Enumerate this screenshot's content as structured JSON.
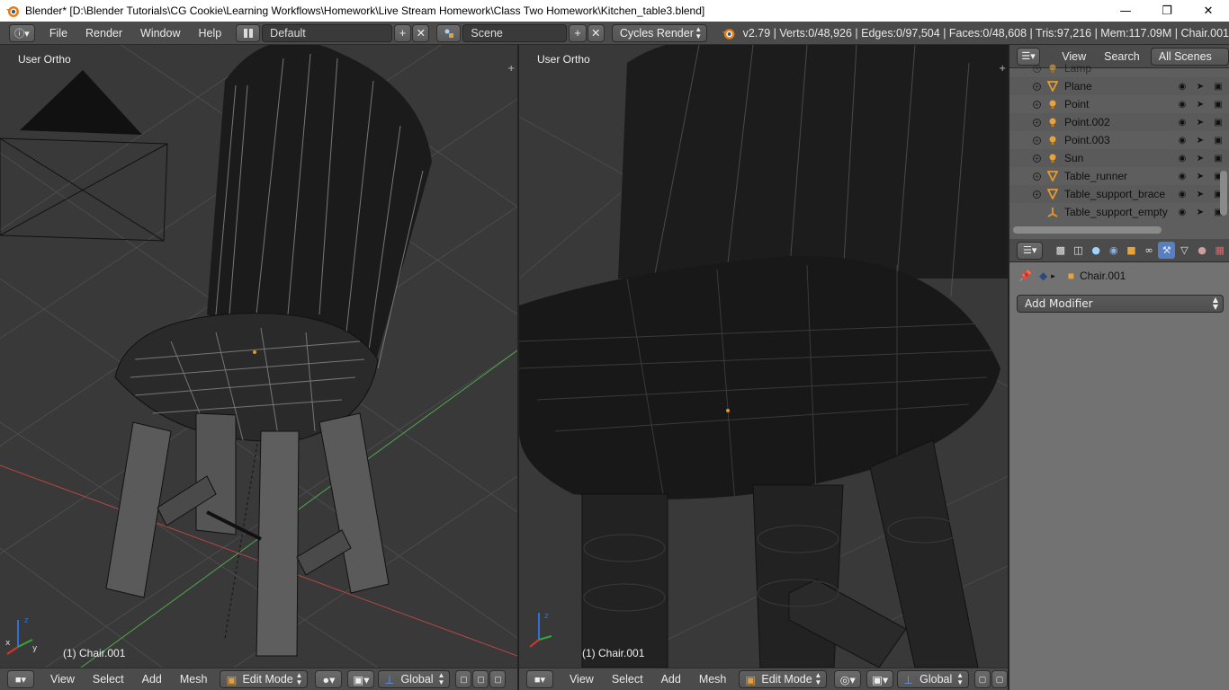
{
  "window": {
    "title": "Blender* [D:\\Blender Tutorials\\CG Cookie\\Learning Workflows\\Homework\\Live Stream Homework\\Class Two Homework\\Kitchen_table3.blend]",
    "minimize": "—",
    "maximize": "❐",
    "close": "✕"
  },
  "info_header": {
    "menus": [
      "File",
      "Render",
      "Window",
      "Help"
    ],
    "screen_layout": "Default",
    "scene": "Scene",
    "render_engine": "Cycles Render",
    "stats": "v2.79 | Verts:0/48,926 | Edges:0/97,504 | Faces:0/48,608 | Tris:97,216 | Mem:117.09M | Chair.001"
  },
  "viewport_left": {
    "label": "User Ortho",
    "object_label": "(1) Chair.001",
    "footer": {
      "menus": [
        "View",
        "Select",
        "Add",
        "Mesh"
      ],
      "mode": "Edit Mode",
      "orientation": "Global"
    }
  },
  "viewport_right": {
    "label": "User Ortho",
    "object_label": "(1) Chair.001",
    "footer": {
      "menus": [
        "View",
        "Select",
        "Add",
        "Mesh"
      ],
      "mode": "Edit Mode",
      "orientation": "Global"
    }
  },
  "outliner": {
    "menus": [
      "View",
      "Search"
    ],
    "filter": "All Scenes",
    "items": [
      {
        "name": "Lamp",
        "icon": "lamp-icon"
      },
      {
        "name": "Plane",
        "icon": "mesh-icon"
      },
      {
        "name": "Point",
        "icon": "lamp-icon"
      },
      {
        "name": "Point.002",
        "icon": "lamp-icon"
      },
      {
        "name": "Point.003",
        "icon": "lamp-icon"
      },
      {
        "name": "Sun",
        "icon": "lamp-icon"
      },
      {
        "name": "Table_runner",
        "icon": "mesh-icon"
      },
      {
        "name": "Table_support_brace",
        "icon": "mesh-icon"
      },
      {
        "name": "Table_support_empty",
        "icon": "empty-icon"
      }
    ]
  },
  "properties": {
    "object_name": "Chair.001",
    "add_modifier": "Add Modifier"
  },
  "colors": {
    "grid": "#4a4a4a",
    "x_axis": "#b44646",
    "y_axis": "#4ea84e",
    "active_tab": "#5680c2",
    "header": "#4b4b4b"
  }
}
